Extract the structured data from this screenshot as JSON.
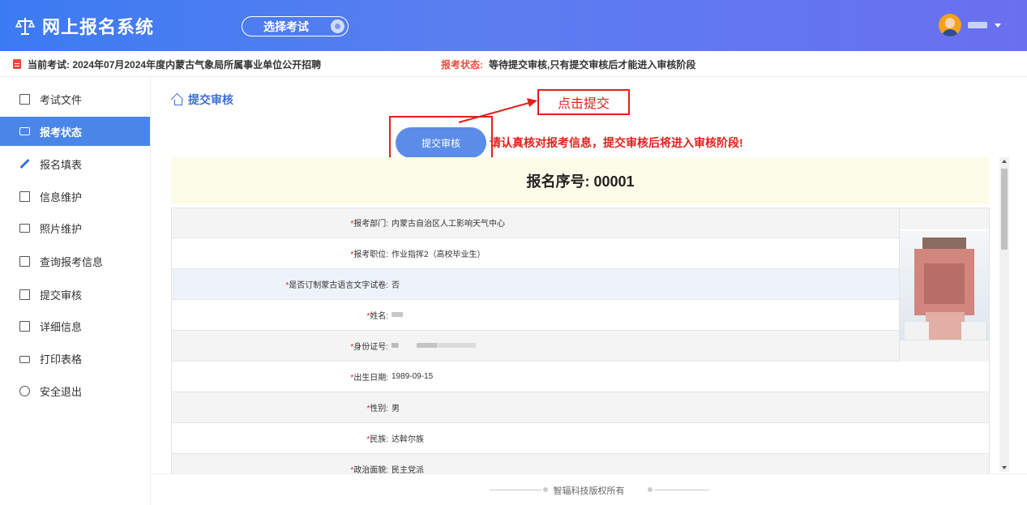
{
  "header": {
    "title": "网上报名系统",
    "select_exam": "选择考试"
  },
  "infobar": {
    "current_exam": "当前考试: 2024年07月2024年度内蒙古气象局所属事业单位公开招聘",
    "status_label": "报考状态:",
    "status_text": "等待提交审核,只有提交审核后才能进入审核阶段"
  },
  "sidebar": {
    "items": [
      {
        "label": "考试文件",
        "icon": "file-icon"
      },
      {
        "label": "报考状态",
        "icon": "monitor-icon",
        "active": true
      },
      {
        "label": "报名填表",
        "icon": "pencil-icon"
      },
      {
        "label": "信息维护",
        "icon": "list-icon"
      },
      {
        "label": "照片维护",
        "icon": "image-icon"
      },
      {
        "label": "查询报考信息",
        "icon": "list-icon"
      },
      {
        "label": "提交审核",
        "icon": "calendar-icon"
      },
      {
        "label": "详细信息",
        "icon": "list-icon"
      },
      {
        "label": "打印表格",
        "icon": "print-icon"
      },
      {
        "label": "安全退出",
        "icon": "power-icon"
      }
    ]
  },
  "main": {
    "breadcrumb": "提交审核",
    "submit_button": "提交审核",
    "warning": "请认真核对报考信息，提交审核后将进入审核阶段!",
    "callout": "点击提交",
    "serial": "报名序号: 00001",
    "fields": [
      {
        "label": "报考部门:",
        "value": "内蒙古自治区人工影响天气中心"
      },
      {
        "label": "报考职位:",
        "value": "作业指挥2（高校毕业生）"
      },
      {
        "label": "是否订制蒙古语言文字试卷:",
        "value": "否"
      },
      {
        "label": "姓名:",
        "value": ""
      },
      {
        "label": "身份证号:",
        "value": ""
      },
      {
        "label": "出生日期:",
        "value": "1989-09-15"
      },
      {
        "label": "性别:",
        "value": "男"
      },
      {
        "label": "民族:",
        "value": "达斡尔族"
      },
      {
        "label": "政治面貌:",
        "value": "民主党派"
      }
    ],
    "star": "*"
  },
  "footer": {
    "text": "智辐科技版权所有"
  }
}
